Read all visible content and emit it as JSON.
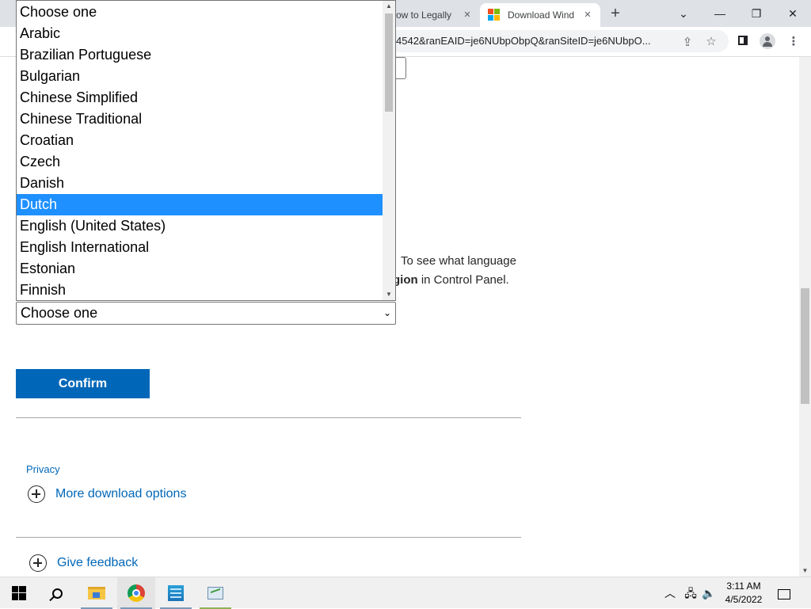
{
  "browser": {
    "tabs": [
      {
        "title": "ow to Legally"
      },
      {
        "title": "Download Wind",
        "active": true
      }
    ],
    "new_tab_glyph": "+",
    "url": "4542&ranEAID=je6NUbpObpQ&ranSiteID=je6NUbpO..."
  },
  "dropdown": {
    "options": [
      "Choose one",
      "Arabic",
      "Brazilian Portuguese",
      "Bulgarian",
      "Chinese Simplified",
      "Chinese Traditional",
      "Croatian",
      "Czech",
      "Danish",
      "Dutch",
      "English (United States)",
      "English International",
      "Estonian",
      "Finnish"
    ],
    "highlighted": "Dutch"
  },
  "content": {
    "info_line1": "To see what language",
    "info_bold_fragment": "gion",
    "info_line2_rest": " in Control Panel.",
    "language_select_value": "Choose one",
    "confirm_label": "Confirm",
    "privacy_label": "Privacy",
    "more_options_label": "More download options",
    "feedback_label": "Give feedback"
  },
  "taskbar": {
    "time": "3:11 AM",
    "date": "4/5/2022"
  },
  "colors": {
    "accent": "#0067b8",
    "highlight": "#1e90ff"
  }
}
